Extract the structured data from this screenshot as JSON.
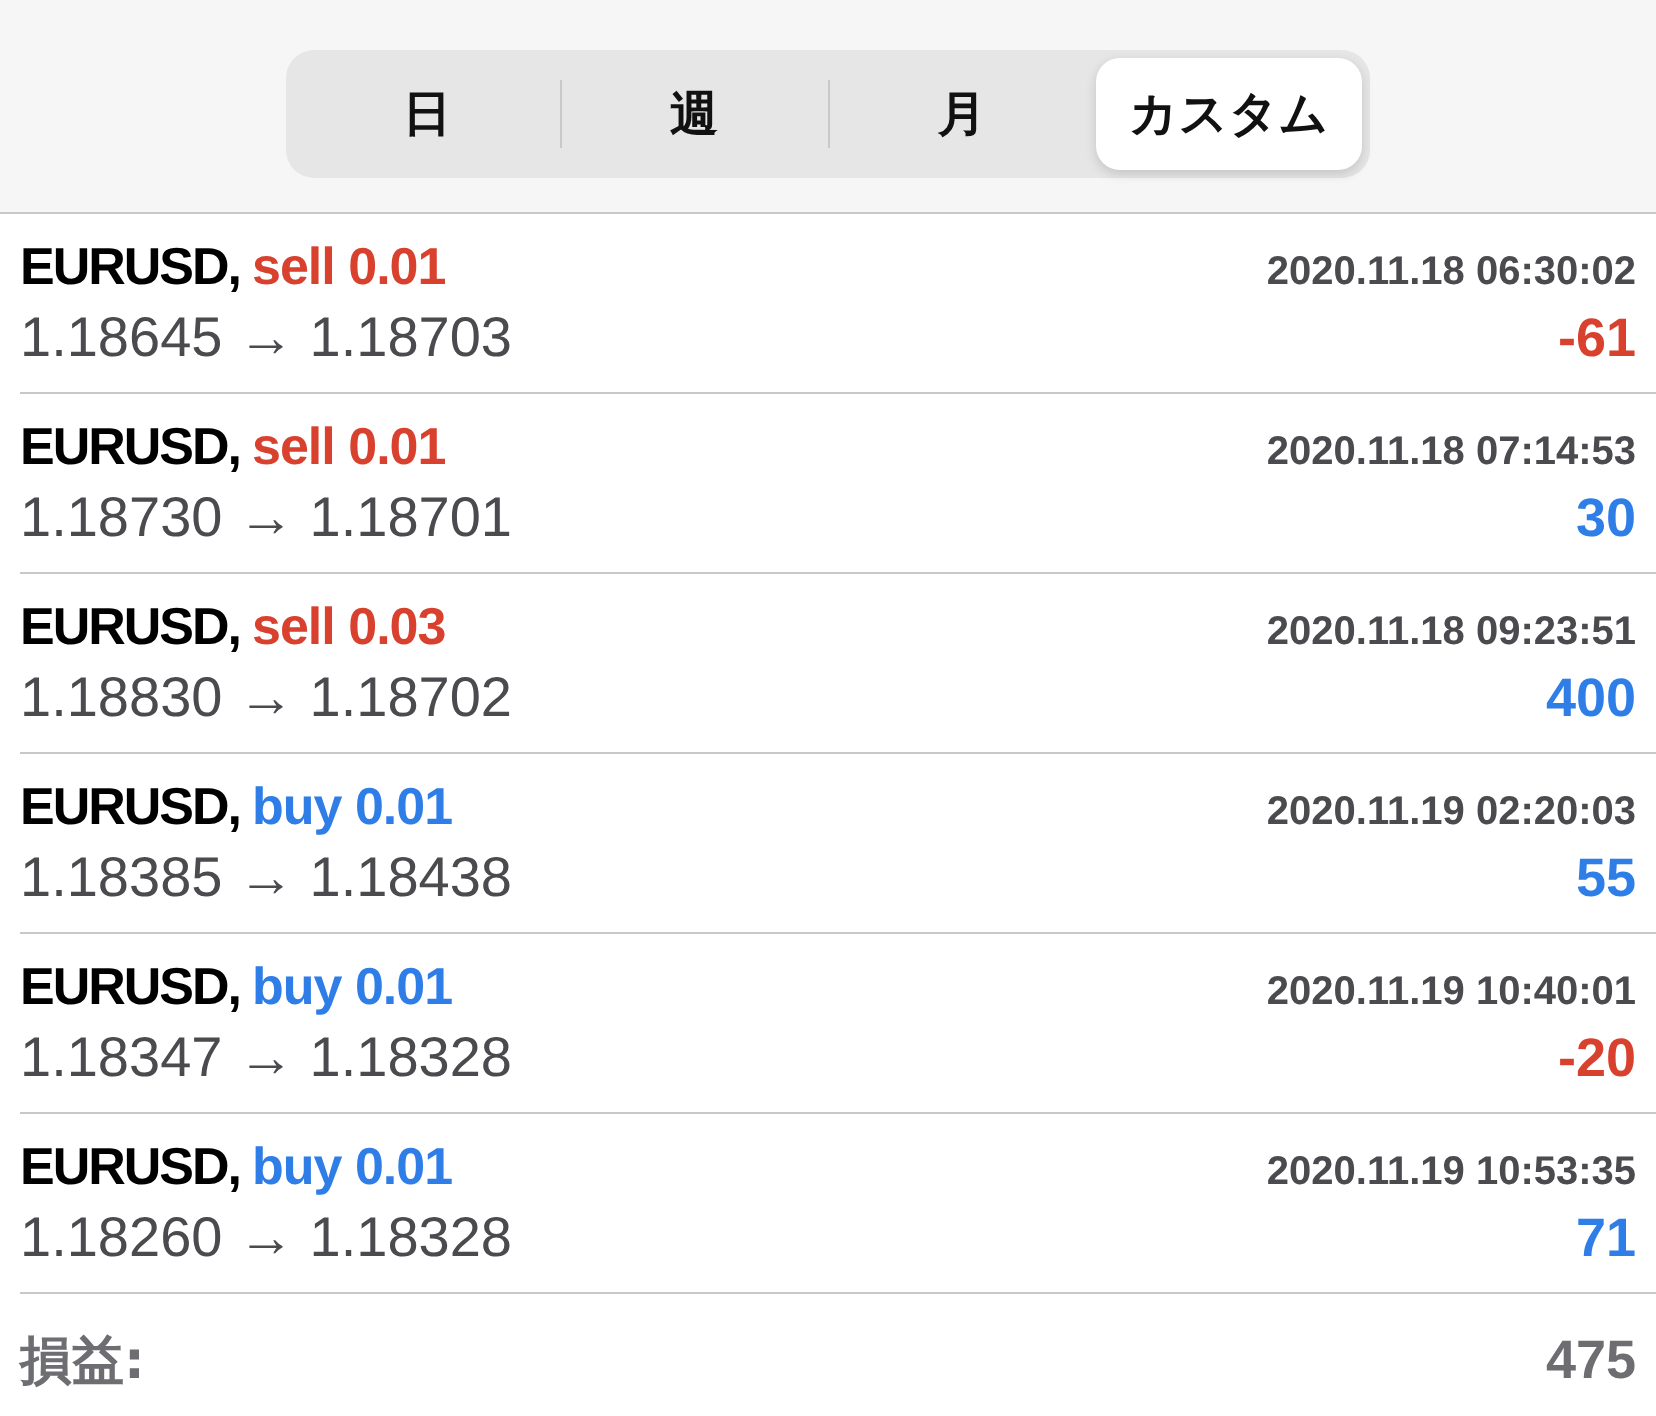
{
  "tabs": [
    {
      "label": "日",
      "selected": false
    },
    {
      "label": "週",
      "selected": false
    },
    {
      "label": "月",
      "selected": false
    },
    {
      "label": "カスタム",
      "selected": true
    }
  ],
  "deals": [
    {
      "symbol": "EURUSD,",
      "order": {
        "text": "sell 0.01",
        "color": "#d9412f"
      },
      "time": "2020.11.18 06:30:02",
      "prices": "1.18645 → 1.18703",
      "profit": {
        "text": "-61",
        "color": "#d9412f"
      }
    },
    {
      "symbol": "EURUSD,",
      "order": {
        "text": "sell 0.01",
        "color": "#d9412f"
      },
      "time": "2020.11.18 07:14:53",
      "prices": "1.18730 → 1.18701",
      "profit": {
        "text": "30",
        "color": "#2f7ee8"
      }
    },
    {
      "symbol": "EURUSD,",
      "order": {
        "text": "sell 0.03",
        "color": "#d9412f"
      },
      "time": "2020.11.18 09:23:51",
      "prices": "1.18830 → 1.18702",
      "profit": {
        "text": "400",
        "color": "#2f7ee8"
      }
    },
    {
      "symbol": "EURUSD,",
      "order": {
        "text": "buy 0.01",
        "color": "#2f7ee8"
      },
      "time": "2020.11.19 02:20:03",
      "prices": "1.18385 → 1.18438",
      "profit": {
        "text": "55",
        "color": "#2f7ee8"
      }
    },
    {
      "symbol": "EURUSD,",
      "order": {
        "text": "buy 0.01",
        "color": "#2f7ee8"
      },
      "time": "2020.11.19 10:40:01",
      "prices": "1.18347 → 1.18328",
      "profit": {
        "text": "-20",
        "color": "#d9412f"
      }
    },
    {
      "symbol": "EURUSD,",
      "order": {
        "text": "buy 0.01",
        "color": "#2f7ee8"
      },
      "time": "2020.11.19 10:53:35",
      "prices": "1.18260 → 1.18328",
      "profit": {
        "text": "71",
        "color": "#2f7ee8"
      }
    }
  ],
  "summary": {
    "label": "損益:",
    "value": "475"
  }
}
